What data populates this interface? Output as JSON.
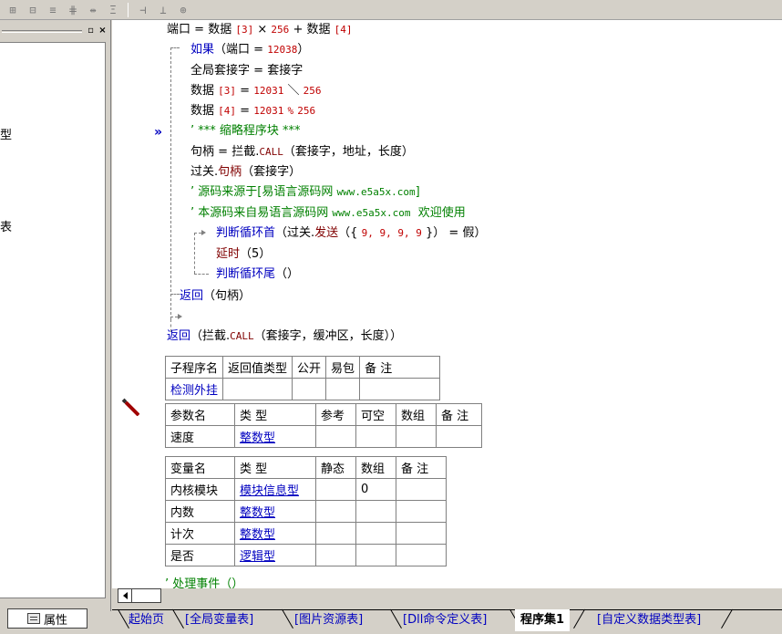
{
  "toolbar": {
    "icons": [
      "align-left-icon",
      "align-center-icon",
      "align-right-icon",
      "align-justify-icon",
      "same-width-icon",
      "same-height-icon",
      "fit-width-icon",
      "fit-height-icon",
      "center-icon"
    ]
  },
  "left_panel": {
    "window_buttons": {
      "restore": "▫",
      "close": "×"
    },
    "fragments": [
      "型",
      "表"
    ],
    "properties_tab": "属性"
  },
  "code": {
    "line1": {
      "a": "端口",
      "b": "=",
      "c": "数据",
      "d": "[3]",
      "e": "×",
      "f": "256",
      "g": "+",
      "h": "数据",
      "i": "[4]"
    },
    "line2": {
      "kw": "如果",
      "p1": "（端口",
      "eq": "=",
      "num": "12038",
      "p2": "）"
    },
    "line3": {
      "a": "全局套接字",
      "eq": "=",
      "b": "套接字"
    },
    "line4": {
      "a": "数据",
      "idx": "[3]",
      "eq": "=",
      "n1": "12031",
      "op": "＼",
      "n2": "256"
    },
    "line5": {
      "a": "数据",
      "idx": "[4]",
      "eq": "=",
      "n1": "12031",
      "op": "%",
      "n2": "256"
    },
    "line6": {
      "cmt": "’ *** 缩略程序块 ***"
    },
    "line7": {
      "a": "句柄",
      "eq": "=",
      "b": "拦截.",
      "call": "CALL",
      "args": "（套接字，地址，长度）"
    },
    "line8": {
      "a": "过关.",
      "b": "句柄",
      "args": "（套接字）"
    },
    "line9": {
      "cmt1": "’ 源码来源于[易语言源码网",
      "url": "www.e5a5x.com",
      "cmt2": "]"
    },
    "line10": {
      "cmt1": "’ 本源码来自易语言源码网",
      "url": "www.e5a5x.com",
      "cmt2": "欢迎使用"
    },
    "line11": {
      "kw": "判断循环首",
      "p1": "（过关.",
      "b": "发送",
      "p2": "（{",
      "nums": "9, 9, 9, 9",
      "p3": "}）",
      "eq": "=",
      "val": "假）"
    },
    "line12": {
      "kw": "延时",
      "args": "（5）"
    },
    "line13": {
      "kw": "判断循环尾",
      "args": "（）"
    },
    "line14": {
      "kw": "返回",
      "args": "（句柄）"
    },
    "line15": {
      "kw": "返回",
      "p1": "（拦截.",
      "call": "CALL",
      "args": "（套接字，缓冲区，长度））"
    },
    "line_bottom": {
      "cmt": "’ 处理事件（）"
    }
  },
  "sub_table": {
    "headers": [
      "子程序名",
      "返回值类型",
      "公开",
      "易包",
      "备 注"
    ],
    "row": {
      "name": "检测外挂",
      "ret": "",
      "pub": "",
      "ebag": "",
      "note": ""
    },
    "param_headers": [
      "参数名",
      "类 型",
      "参考",
      "可空",
      "数组",
      "备 注"
    ],
    "params": [
      {
        "name": "速度",
        "type": "整数型",
        "ref": "",
        "null": "",
        "arr": "",
        "note": ""
      }
    ]
  },
  "var_table": {
    "headers": [
      "变量名",
      "类 型",
      "静态",
      "数组",
      "备 注"
    ],
    "rows": [
      {
        "name": "内核模块",
        "type": "模块信息型",
        "static": "",
        "arr": "0",
        "note": ""
      },
      {
        "name": "内数",
        "type": "整数型",
        "static": "",
        "arr": "",
        "note": ""
      },
      {
        "name": "计次",
        "type": "整数型",
        "static": "",
        "arr": "",
        "note": ""
      },
      {
        "name": "是否",
        "type": "逻辑型",
        "static": "",
        "arr": "",
        "note": ""
      }
    ]
  },
  "bottom_tabs": [
    "起始页",
    "[全局变量表]",
    "[图片资源表]",
    "[Dll命令定义表]",
    "程序集1",
    "[自定义数据类型表]"
  ]
}
